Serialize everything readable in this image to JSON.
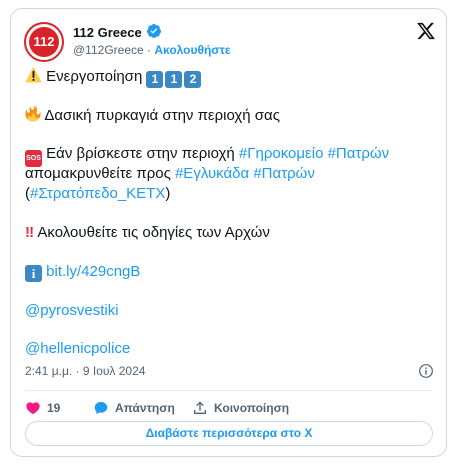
{
  "account": {
    "name": "112 Greece",
    "handle": "@112Greece",
    "separator": "·",
    "follow_label": "Ακολουθήστε",
    "avatar_text": "112"
  },
  "tweet": {
    "line1_text": "Ενεργοποίηση",
    "line1_digits": [
      "1",
      "1",
      "2"
    ],
    "line2_text": "Δασική πυρκαγιά στην περιοχή σας",
    "line3_text": "Εάν βρίσκεστε στην περιοχή",
    "hashtag1": "#Γηροκομείο",
    "hashtag2": "#Πατρών",
    "line4_text": "απομακρυνθείτε προς",
    "hashtag3": "#Εγλυκάδα",
    "hashtag4": "#Πατρών",
    "line5_open": "(",
    "hashtag5": "#Στρατόπεδο_ΚΕΤΧ",
    "line5_close": ")",
    "line6_text": "Ακολουθείτε τις οδηγίες των Αρχών",
    "link": "bit.ly/429cngB",
    "mention1": "@pyrosvestiki",
    "mention2": "@hellenicpolice",
    "timestamp": "2:41 μ.μ. · 9 Ιουλ 2024"
  },
  "icons": {
    "warning": "warning-icon",
    "fire": "fire-icon",
    "sos": "SOS",
    "info": "i",
    "exclamation": "‼"
  },
  "actions": {
    "likes": "19",
    "reply_label": "Απάντηση",
    "share_label": "Κοινοποίηση"
  },
  "read_more_label": "Διαβάστε περισσότερα στο X",
  "colors": {
    "accent": "#1d9bf0",
    "brand_red": "#d8232a",
    "like": "#f91880"
  }
}
